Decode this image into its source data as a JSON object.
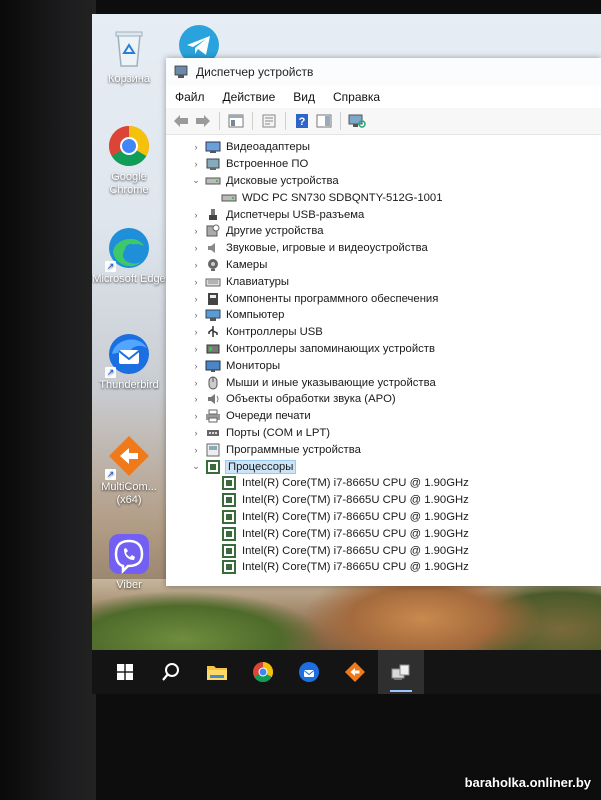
{
  "desktop": {
    "icons": [
      {
        "label": "Корзина"
      },
      {
        "label": "Google Chrome"
      },
      {
        "label": "Microsoft Edge"
      },
      {
        "label": "Thunderbird"
      },
      {
        "label": "MultiCom... (x64)"
      },
      {
        "label": "Viber"
      }
    ]
  },
  "window": {
    "title": "Диспетчер устройств",
    "menu": [
      "Файл",
      "Действие",
      "Вид",
      "Справка"
    ],
    "tree": [
      {
        "label": "Видеоадаптеры",
        "icon": "display-adapter-icon",
        "expanded": false
      },
      {
        "label": "Встроенное ПО",
        "icon": "firmware-icon",
        "expanded": false
      },
      {
        "label": "Дисковые устройства",
        "icon": "disk-drive-icon",
        "expanded": true
      },
      {
        "label": "WDC PC SN730 SDBQNTY-512G-1001",
        "icon": "disk-drive-icon",
        "child": true
      },
      {
        "label": "Диспетчеры USB-разъема",
        "icon": "usb-connector-icon",
        "expanded": false
      },
      {
        "label": "Другие устройства",
        "icon": "unknown-device-icon",
        "expanded": false
      },
      {
        "label": "Звуковые, игровые и видеоустройства",
        "icon": "speaker-icon",
        "expanded": false
      },
      {
        "label": "Камеры",
        "icon": "camera-icon",
        "expanded": false
      },
      {
        "label": "Клавиатуры",
        "icon": "keyboard-icon",
        "expanded": false
      },
      {
        "label": "Компоненты программного обеспечения",
        "icon": "software-component-icon",
        "expanded": false
      },
      {
        "label": "Компьютер",
        "icon": "computer-icon",
        "expanded": false
      },
      {
        "label": "Контроллеры USB",
        "icon": "usb-icon",
        "expanded": false
      },
      {
        "label": "Контроллеры запоминающих устройств",
        "icon": "storage-controller-icon",
        "expanded": false
      },
      {
        "label": "Мониторы",
        "icon": "monitor-icon",
        "expanded": false
      },
      {
        "label": "Мыши и иные указывающие устройства",
        "icon": "mouse-icon",
        "expanded": false
      },
      {
        "label": "Объекты обработки звука (APO)",
        "icon": "audio-processing-icon",
        "expanded": false
      },
      {
        "label": "Очереди печати",
        "icon": "printer-icon",
        "expanded": false
      },
      {
        "label": "Порты (COM и LPT)",
        "icon": "port-icon",
        "expanded": false
      },
      {
        "label": "Программные устройства",
        "icon": "software-device-icon",
        "expanded": false
      },
      {
        "label": "Процессоры",
        "icon": "processor-icon",
        "expanded": true,
        "selected": true
      },
      {
        "label": "Intel(R) Core(TM) i7-8665U CPU @ 1.90GHz",
        "icon": "processor-icon",
        "child": true
      },
      {
        "label": "Intel(R) Core(TM) i7-8665U CPU @ 1.90GHz",
        "icon": "processor-icon",
        "child": true
      },
      {
        "label": "Intel(R) Core(TM) i7-8665U CPU @ 1.90GHz",
        "icon": "processor-icon",
        "child": true
      },
      {
        "label": "Intel(R) Core(TM) i7-8665U CPU @ 1.90GHz",
        "icon": "processor-icon",
        "child": true
      },
      {
        "label": "Intel(R) Core(TM) i7-8665U CPU @ 1.90GHz",
        "icon": "processor-icon",
        "child": true
      },
      {
        "label": "Intel(R) Core(TM) i7-8665U CPU @ 1.90GHz",
        "icon": "processor-icon",
        "child": true
      }
    ]
  },
  "taskbar": {
    "items": [
      "start-icon",
      "search-icon",
      "file-explorer-icon",
      "chrome-icon",
      "thunderbird-icon",
      "multicommander-icon",
      "device-manager-icon"
    ]
  },
  "watermark": "baraholka.onliner.by",
  "colors": {
    "selection": "#cce4f7",
    "taskbar": "#141414",
    "accent": "#9ec6ff"
  }
}
